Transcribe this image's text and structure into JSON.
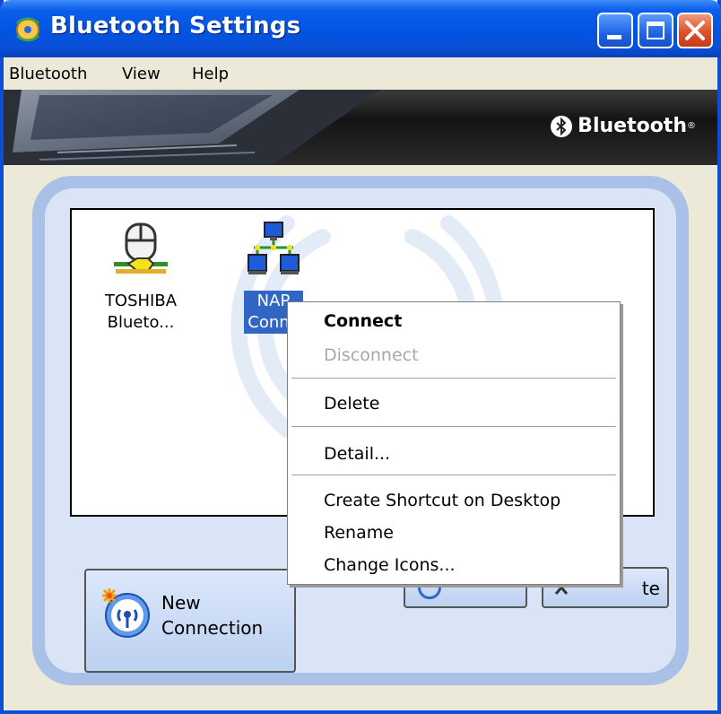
{
  "window": {
    "title": "Bluetooth Settings",
    "controls": [
      "minimize-icon",
      "maximize-icon",
      "close-icon"
    ]
  },
  "menubar": {
    "items": [
      "Bluetooth",
      "View",
      "Help"
    ]
  },
  "banner": {
    "brand": "Bluetooth",
    "brand_mark": "®"
  },
  "devices": [
    {
      "label_line1": "TOSHIBA",
      "label_line2": "Blueto...",
      "icon": "mouse-device-icon",
      "selected": false
    },
    {
      "label_line1": "NAP",
      "label_line2": "Conne",
      "icon": "network-icon",
      "selected": true
    }
  ],
  "buttons": {
    "new_connection_line1": "New",
    "new_connection_line2": "Connection",
    "partial_button_label": "te"
  },
  "context_menu": {
    "items": [
      {
        "label": "Connect",
        "style": "bold"
      },
      {
        "label": "Disconnect",
        "style": "disabled"
      },
      {
        "label": "Delete",
        "style": "normal"
      },
      {
        "label": "Detail...",
        "style": "normal"
      },
      {
        "label": "Create Shortcut on Desktop",
        "style": "normal"
      },
      {
        "label": "Rename",
        "style": "normal"
      },
      {
        "label": "Change Icons...",
        "style": "normal"
      }
    ]
  },
  "colors": {
    "titlebar_blue": "#0254e2",
    "close_red": "#e0502a",
    "selection_blue": "#3166c5",
    "panel_blue": "#a9c1e6"
  }
}
